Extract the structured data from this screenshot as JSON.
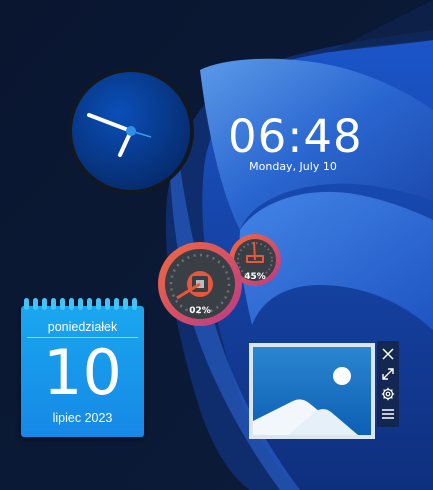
{
  "colors": {
    "background": "#0b1a33",
    "accent": "#1a90e8",
    "meter_ring": "#e8573b"
  },
  "digital_clock": {
    "time": "06:48",
    "date": "Monday, July 10"
  },
  "analog_clock": {
    "hour": 6,
    "minute": 48
  },
  "meters": {
    "cpu_label": "02%",
    "memory_label": "45%",
    "cpu_value": 2,
    "memory_value": 45
  },
  "calendar": {
    "weekday": "poniedziałek",
    "day": "10",
    "month_year": "lipiec 2023"
  },
  "photo_widget": {
    "icon": "image-placeholder-icon",
    "toolbar": [
      "close-icon",
      "resize-icon",
      "gear-icon",
      "menu-icon"
    ]
  }
}
